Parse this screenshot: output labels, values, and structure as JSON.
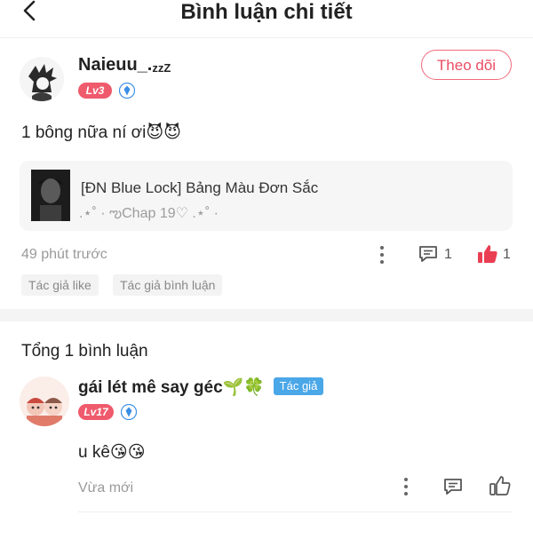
{
  "header": {
    "title": "Bình luận chi tiết"
  },
  "comment": {
    "username": "Naieuu_.",
    "username_zz": "zzZ",
    "level": "Lv3",
    "follow_label": "Theo dõi",
    "content": "1 bông nữa ní ơi",
    "content_emoji": "😈😈",
    "time": "49 phút trước",
    "reply_count": "1",
    "like_count": "1",
    "tags": [
      "Tác giả like",
      "Tác giả bình luận"
    ]
  },
  "story_card": {
    "title": "[ĐN Blue Lock] Bảng Màu Đơn Sắc",
    "subtitle": ".⋆˚ · ఌChap 19♡ .⋆˚ ·"
  },
  "replies_section": {
    "total_label": "Tổng 1 bình luận",
    "reply": {
      "username": "gái lét mê say géc",
      "username_emoji": "🌱🍀",
      "author_badge": "Tác giả",
      "level": "Lv17",
      "content": "u kê",
      "content_emoji": "😘😘",
      "time": "Vừa mới"
    }
  },
  "colors": {
    "accent": "#ec4d62",
    "like": "#ea3e52",
    "author_badge": "#4aa7e8",
    "level_badge": "#ef5a6c",
    "shield": "#3a8ee6"
  }
}
